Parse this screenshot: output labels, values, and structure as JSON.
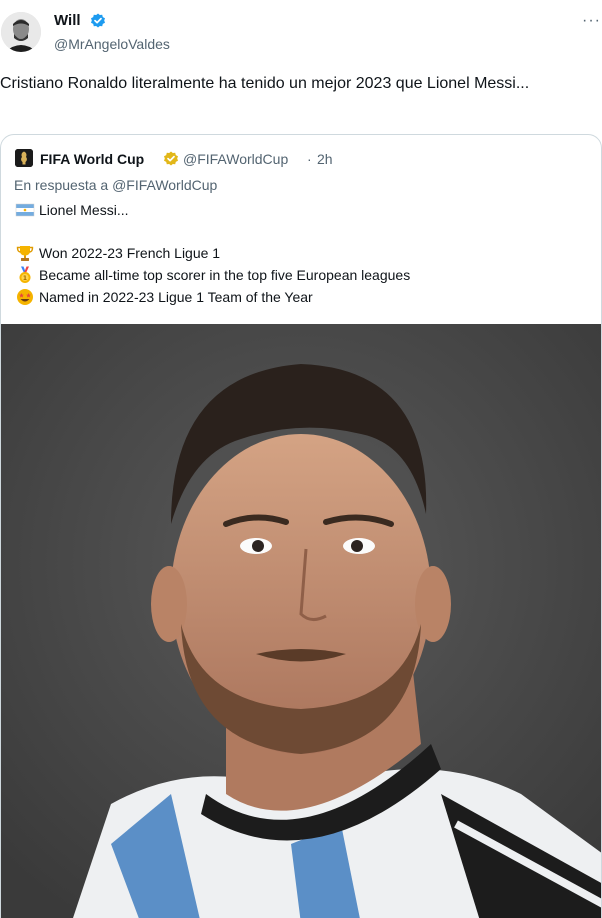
{
  "tweet": {
    "author_name": "Will",
    "author_handle": "@MrAngeloValdes",
    "more_label": "···",
    "text": "Cristiano Ronaldo literalmente ha tenido un mejor 2023 que Lionel Messi..."
  },
  "quote": {
    "author_name": "FIFA World Cup",
    "author_handle": "@FIFAWorldCup",
    "separator": "·",
    "time": "2h",
    "reply_prefix": "En respuesta a",
    "reply_handle": "@FIFAWorldCup",
    "lines": [
      {
        "icon": "argentina-flag-icon",
        "text": "Lionel Messi..."
      },
      {
        "icon": "trophy-icon",
        "text": "Won 2022-23 French Ligue 1"
      },
      {
        "icon": "medal-icon",
        "text": "Became all-time top scorer in the top five European leagues"
      },
      {
        "icon": "star-struck-icon",
        "text": "Named in 2022-23 Ligue 1 Team of the Year"
      }
    ]
  },
  "colors": {
    "verified_blue": "#1d9bf0",
    "verified_gold": "#e2b719",
    "secondary_text": "#536471",
    "border": "#cfd9de"
  }
}
